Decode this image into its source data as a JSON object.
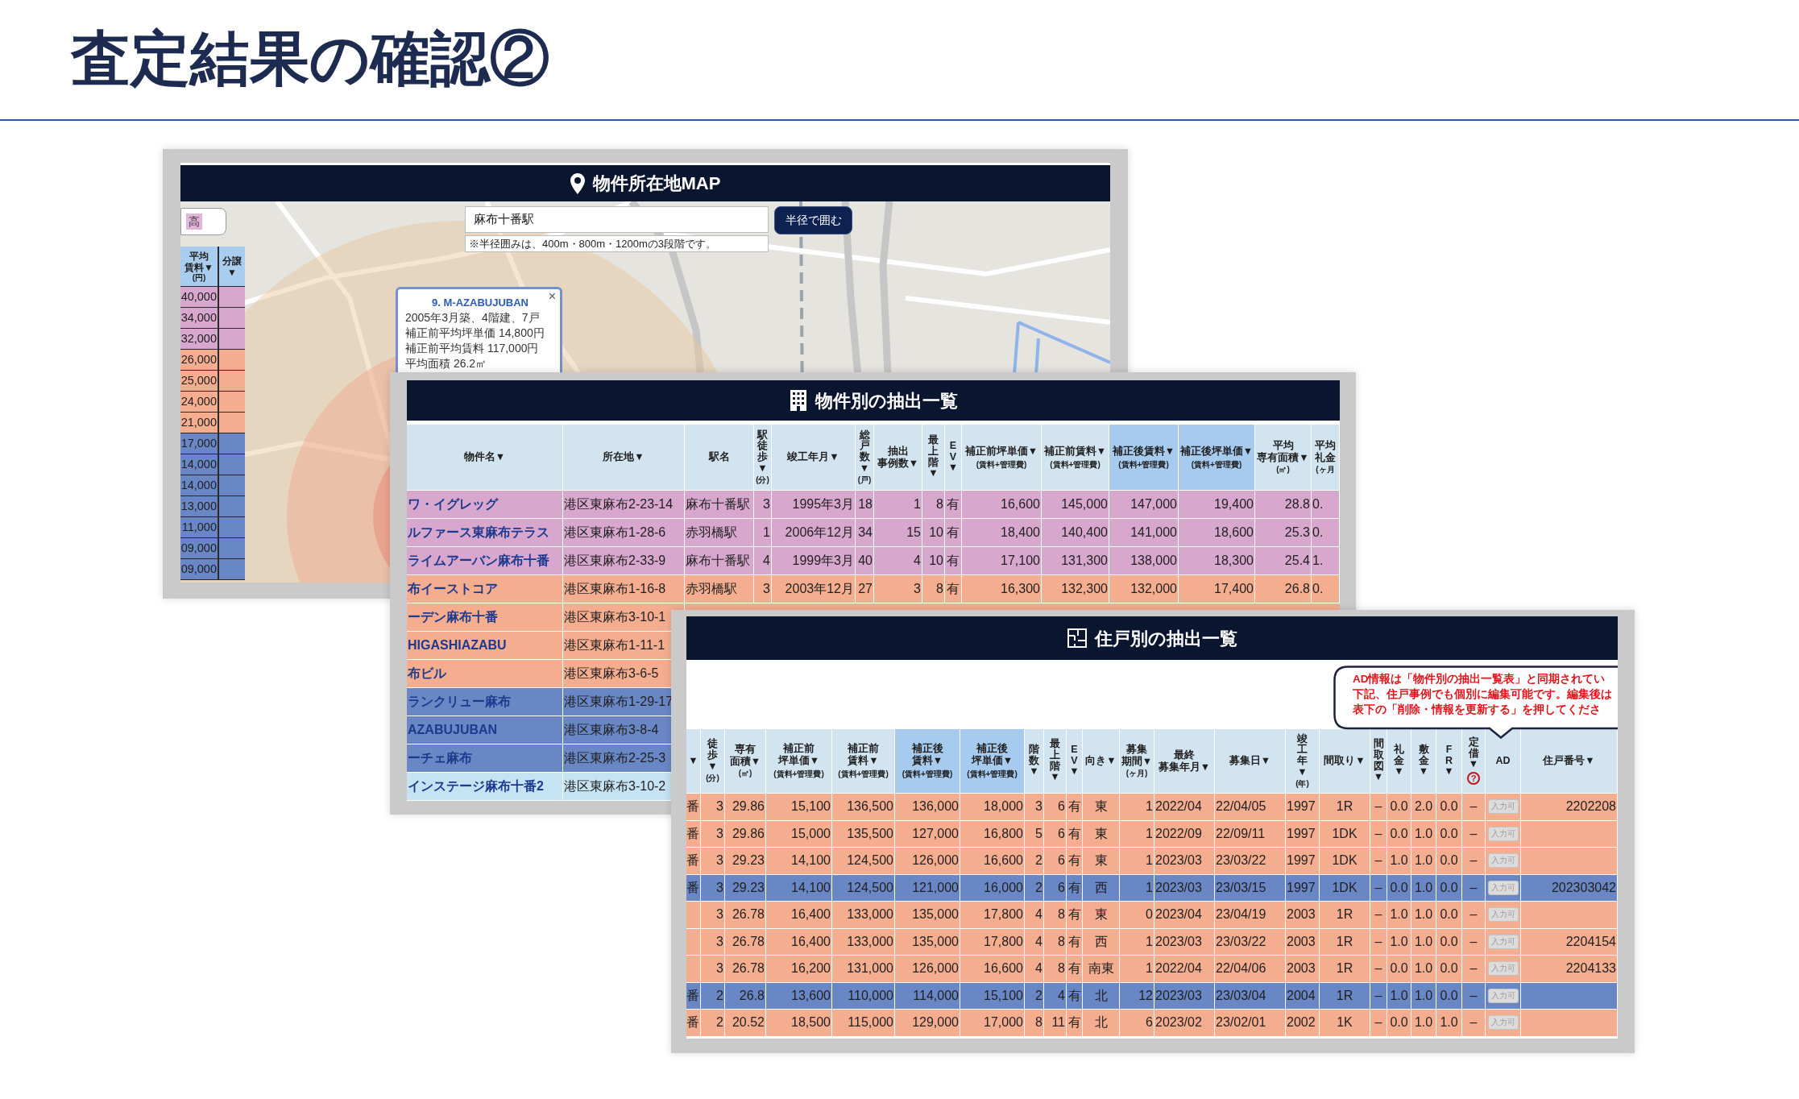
{
  "page_title": "査定結果の確認②",
  "map_panel": {
    "title": "物件所在地MAP",
    "filter_tag": "高",
    "side_table": {
      "columns": [
        {
          "label": "平均賃料▼",
          "unit": "(円)"
        },
        {
          "label": "分譲▼"
        }
      ],
      "rows": [
        {
          "rent": "40,000",
          "color": "#d7a7cd"
        },
        {
          "rent": "34,000",
          "color": "#d7a7cd"
        },
        {
          "rent": "32,000",
          "color": "#d7a7cd"
        },
        {
          "rent": "26,000",
          "color": "#f4ae8f"
        },
        {
          "rent": "25,000",
          "color": "#f4ae8f"
        },
        {
          "rent": "24,000",
          "color": "#f4ae8f"
        },
        {
          "rent": "21,000",
          "color": "#f4ae8f"
        },
        {
          "rent": "17,000",
          "color": "#6a87c5"
        },
        {
          "rent": "14,000",
          "color": "#6a87c5"
        },
        {
          "rent": "14,000",
          "color": "#6a87c5"
        },
        {
          "rent": "13,000",
          "color": "#6a87c5"
        },
        {
          "rent": "11,000",
          "color": "#6a87c5"
        },
        {
          "rent": "09,000",
          "color": "#6a87c5"
        },
        {
          "rent": "09,000",
          "color": "#6a87c5"
        }
      ]
    },
    "search": {
      "value": "麻布十番駅"
    },
    "note": "※半径囲みは、400m・800m・1200mの3段階です。",
    "button": "半径で囲む",
    "popup": {
      "title": "9. M-AZABUJUBAN",
      "close": "×",
      "lines": [
        "2005年3月築、4階建、7戸",
        "補正前平均坪単価 14,800円",
        "補正前平均賃料 117,000円",
        "平均面積 26.2㎡"
      ]
    }
  },
  "property_table": {
    "title": "物件別の抽出一覧",
    "columns": [
      {
        "label": "物件名▼",
        "highlighted": false
      },
      {
        "label": "所在地▼",
        "highlighted": false
      },
      {
        "label": "駅名",
        "highlighted": false
      },
      {
        "label": "駅徒歩▼",
        "unit": "(分)",
        "highlighted": false
      },
      {
        "label": "竣工年月▼",
        "highlighted": false
      },
      {
        "label": "総戸数▼",
        "unit": "(戸)",
        "highlighted": false
      },
      {
        "label": "抽出事例数▼",
        "highlighted": false
      },
      {
        "label": "最上階▼",
        "highlighted": false
      },
      {
        "label": "EV▼",
        "highlighted": false
      },
      {
        "label": "補正前坪単価▼",
        "sub": "(賃料+管理費)",
        "highlighted": false
      },
      {
        "label": "補正前賃料▼",
        "sub": "(賃料+管理費)",
        "highlighted": false
      },
      {
        "label": "補正後賃料▼",
        "sub": "(賃料+管理費)",
        "highlighted": true
      },
      {
        "label": "補正後坪単価▼",
        "sub": "(賃料+管理費)",
        "highlighted": true
      },
      {
        "label": "平均専有面積▼",
        "unit": "(㎡)",
        "highlighted": false
      },
      {
        "label": "平均礼金",
        "unit": "(ヶ月",
        "highlighted": false
      }
    ],
    "rows": [
      {
        "color": "#d7a7cd",
        "cells": [
          "ワ・イグレッグ",
          "港区東麻布2-23-14",
          "麻布十番駅",
          "3",
          "1995年3月",
          "18",
          "1",
          "8",
          "有",
          "16,600",
          "145,000",
          "147,000",
          "19,400",
          "28.8",
          "0."
        ]
      },
      {
        "color": "#d7a7cd",
        "cells": [
          "ルファース東麻布テラス",
          "港区東麻布1-28-6",
          "赤羽橋駅",
          "1",
          "2006年12月",
          "34",
          "15",
          "10",
          "有",
          "18,400",
          "140,400",
          "141,000",
          "18,600",
          "25.3",
          "0."
        ]
      },
      {
        "color": "#d7a7cd",
        "cells": [
          "ライムアーバン麻布十番",
          "港区東麻布2-33-9",
          "麻布十番駅",
          "4",
          "1999年3月",
          "40",
          "4",
          "10",
          "有",
          "17,100",
          "131,300",
          "138,000",
          "18,300",
          "25.4",
          "1."
        ]
      },
      {
        "color": "#f4ae8f",
        "cells": [
          "布イーストコア",
          "港区東麻布1-16-8",
          "赤羽橋駅",
          "3",
          "2003年12月",
          "27",
          "3",
          "8",
          "有",
          "16,300",
          "132,300",
          "132,000",
          "17,400",
          "26.8",
          "0."
        ]
      },
      {
        "color": "#f4ae8f",
        "cells": [
          "ーデン麻布十番",
          "港区東麻布3-10-1"
        ]
      },
      {
        "color": "#f4ae8f",
        "cells": [
          "HIGASHIAZABU",
          "港区東麻布1-11-1"
        ]
      },
      {
        "color": "#f4ae8f",
        "cells": [
          "布ビル",
          "港区東麻布3-6-5"
        ]
      },
      {
        "color": "#6a87c5",
        "cells": [
          "ランクリュー麻布",
          "港区東麻布1-29-17"
        ]
      },
      {
        "color": "#6a87c5",
        "cells": [
          "AZABUJUBAN",
          "港区東麻布3-8-4"
        ]
      },
      {
        "color": "#6a87c5",
        "cells": [
          "ーチェ麻布",
          "港区東麻布2-25-3"
        ]
      },
      {
        "color": "#c6e3f3",
        "cells": [
          "インステージ麻布十番2",
          "港区東麻布3-10-2"
        ]
      }
    ]
  },
  "unit_table": {
    "title": "住戸別の抽出一覧",
    "callout": [
      "AD情報は「物件別の抽出一覧表」と同期されてい",
      "下記、住戸事例でも個別に編集可能です。編集後は",
      "表下の「削除・情報を更新する」を押してくださ"
    ],
    "columns": [
      {
        "label": "▼",
        "highlighted": false
      },
      {
        "label": "徒歩▼",
        "unit": "(分)",
        "highlighted": false
      },
      {
        "label": "専有面積▼",
        "unit": "(㎡)",
        "highlighted": false
      },
      {
        "label": "補正前坪単価▼",
        "sub": "(賃料+管理費)",
        "highlighted": false
      },
      {
        "label": "補正前賃料▼",
        "sub": "(賃料+管理費)",
        "highlighted": false
      },
      {
        "label": "補正後賃料▼",
        "sub": "(賃料+管理費)",
        "highlighted": true
      },
      {
        "label": "補正後坪単価▼",
        "sub": "(賃料+管理費)",
        "highlighted": true
      },
      {
        "label": "階数▼",
        "highlighted": false
      },
      {
        "label": "最上階▼",
        "highlighted": false
      },
      {
        "label": "EV▼",
        "highlighted": false
      },
      {
        "label": "向き▼",
        "highlighted": false
      },
      {
        "label": "募集期間▼",
        "unit": "(ヶ月)",
        "highlighted": false
      },
      {
        "label": "最終募集年月▼",
        "highlighted": false
      },
      {
        "label": "募集日▼",
        "highlighted": false
      },
      {
        "label": "竣工年▼",
        "unit": "(年)",
        "highlighted": false
      },
      {
        "label": "間取り▼",
        "highlighted": false
      },
      {
        "label": "間取図▼",
        "highlighted": false
      },
      {
        "label": "礼金▼",
        "highlighted": false
      },
      {
        "label": "敷金▼",
        "highlighted": false
      },
      {
        "label": "FR▼",
        "highlighted": false
      },
      {
        "label": "定借▼",
        "help": "?",
        "highlighted": false
      },
      {
        "label": "AD",
        "highlighted": false
      },
      {
        "label": "住戸番号▼",
        "highlighted": false
      }
    ],
    "rows": [
      {
        "color": "#f4ae8f",
        "cells": [
          "番",
          "3",
          "29.86",
          "15,100",
          "136,500",
          "136,000",
          "18,000",
          "3",
          "6",
          "有",
          "東",
          "1",
          "2022/04",
          "22/04/05",
          "1997",
          "1R",
          "–",
          "0.0",
          "2.0",
          "0.0",
          "–",
          "入力可",
          "2202208"
        ]
      },
      {
        "color": "#f4ae8f",
        "cells": [
          "番",
          "3",
          "29.86",
          "15,000",
          "135,500",
          "127,000",
          "16,800",
          "5",
          "6",
          "有",
          "東",
          "1",
          "2022/09",
          "22/09/11",
          "1997",
          "1DK",
          "–",
          "0.0",
          "1.0",
          "0.0",
          "–",
          "入力可"
        ]
      },
      {
        "color": "#f4ae8f",
        "cells": [
          "番",
          "3",
          "29.23",
          "14,100",
          "124,500",
          "126,000",
          "16,600",
          "2",
          "6",
          "有",
          "東",
          "1",
          "2023/03",
          "23/03/22",
          "1997",
          "1DK",
          "–",
          "1.0",
          "1.0",
          "0.0",
          "–",
          "入力可"
        ]
      },
      {
        "color": "#6a87c5",
        "cells": [
          "番",
          "3",
          "29.23",
          "14,100",
          "124,500",
          "121,000",
          "16,000",
          "2",
          "6",
          "有",
          "西",
          "1",
          "2023/03",
          "23/03/15",
          "1997",
          "1DK",
          "–",
          "0.0",
          "1.0",
          "0.0",
          "–",
          "入力可",
          "202303042"
        ]
      },
      {
        "color": "#f4ae8f",
        "cells": [
          "",
          "3",
          "26.78",
          "16,400",
          "133,000",
          "135,000",
          "17,800",
          "4",
          "8",
          "有",
          "東",
          "0",
          "2023/04",
          "23/04/19",
          "2003",
          "1R",
          "–",
          "1.0",
          "1.0",
          "0.0",
          "–",
          "入力可"
        ]
      },
      {
        "color": "#f4ae8f",
        "cells": [
          "",
          "3",
          "26.78",
          "16,400",
          "133,000",
          "135,000",
          "17,800",
          "4",
          "8",
          "有",
          "西",
          "1",
          "2023/03",
          "23/03/22",
          "2003",
          "1R",
          "–",
          "1.0",
          "1.0",
          "0.0",
          "–",
          "入力可",
          "2204154"
        ]
      },
      {
        "color": "#f4ae8f",
        "cells": [
          "",
          "3",
          "26.78",
          "16,200",
          "131,000",
          "126,000",
          "16,600",
          "4",
          "8",
          "有",
          "南東",
          "1",
          "2022/04",
          "22/04/06",
          "2003",
          "1R",
          "–",
          "0.0",
          "1.0",
          "0.0",
          "–",
          "入力可",
          "2204133"
        ]
      },
      {
        "color": "#6a87c5",
        "cells": [
          "番",
          "2",
          "26.8",
          "13,600",
          "110,000",
          "114,000",
          "15,100",
          "2",
          "4",
          "有",
          "北",
          "12",
          "2023/03",
          "23/03/04",
          "2004",
          "1R",
          "–",
          "1.0",
          "1.0",
          "0.0",
          "–",
          "入力可"
        ]
      },
      {
        "color": "#f4ae8f",
        "cells": [
          "番",
          "2",
          "20.52",
          "18,500",
          "115,000",
          "129,000",
          "17,000",
          "8",
          "11",
          "有",
          "北",
          "6",
          "2023/02",
          "23/02/01",
          "2002",
          "1K",
          "–",
          "0.0",
          "1.0",
          "1.0",
          "–",
          "入力可"
        ]
      }
    ]
  }
}
